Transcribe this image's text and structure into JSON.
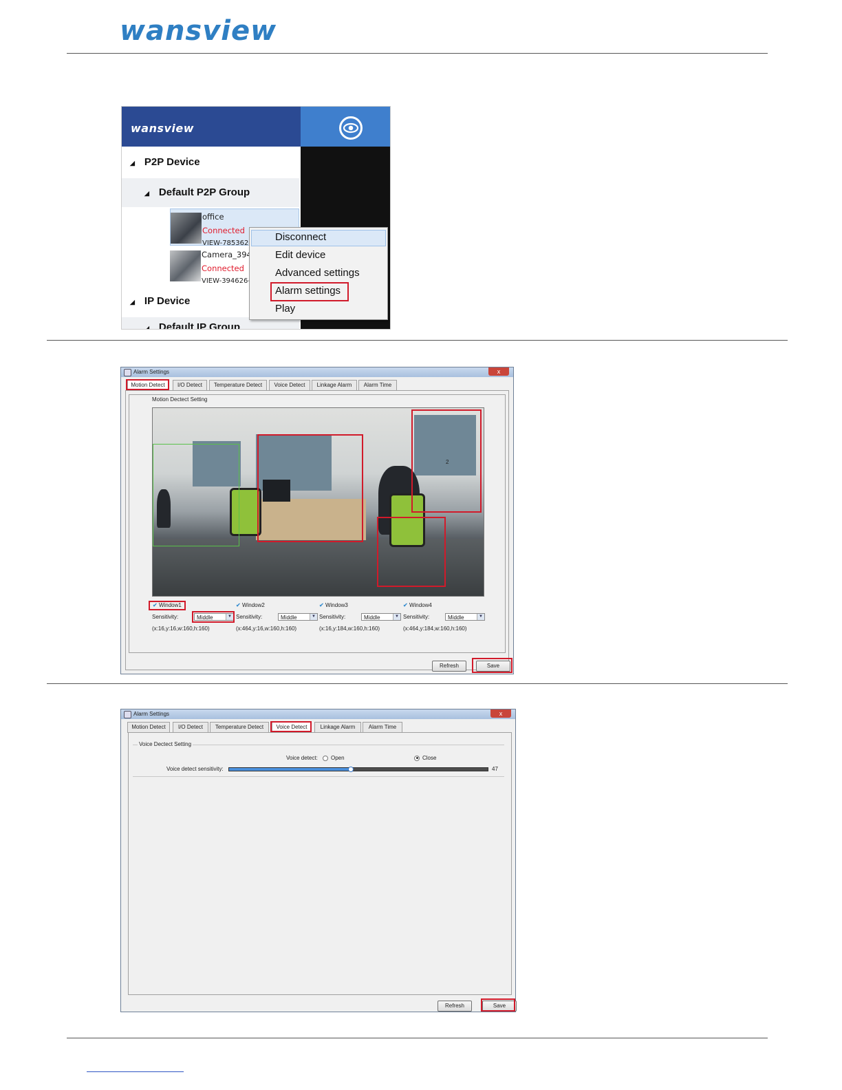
{
  "header": {
    "logo_text": "wansview"
  },
  "panel1": {
    "brand": "wansview",
    "tree": {
      "p2p_device": "P2P Device",
      "default_group": "Default P2P Group",
      "ip_device": "IP Device",
      "partial_next": "Default IP Group"
    },
    "devices": [
      {
        "name": "office",
        "status": "Connected",
        "id": "VIEW-785362-"
      },
      {
        "name": "Camera_394",
        "status": "Connected",
        "id": "VIEW-394626-"
      }
    ],
    "context_menu": [
      "Disconnect",
      "Edit device",
      "Advanced settings",
      "Alarm settings",
      "Play"
    ]
  },
  "dialog1": {
    "title": "Alarm Settings",
    "close": "x",
    "tabs": [
      "Motion Detect",
      "I/O Detect",
      "Temperature Detect",
      "Voice Detect",
      "Linkage Alarm",
      "Alarm Time"
    ],
    "section_title": "Motion Dectect Setting",
    "region_label": "2",
    "windows": [
      {
        "label": "Window1",
        "sensitivity_label": "Sensitivity:",
        "sensitivity": "Middle",
        "coords": "(x:16,y:16,w:160,h:160)"
      },
      {
        "label": "Window2",
        "sensitivity_label": "Sensitivity:",
        "sensitivity": "Middle",
        "coords": "(x:464,y:16,w:160,h:160)"
      },
      {
        "label": "Window3",
        "sensitivity_label": "Sensitivity:",
        "sensitivity": "Middle",
        "coords": "(x:16,y:184,w:160,h:160)"
      },
      {
        "label": "Window4",
        "sensitivity_label": "Sensitivity:",
        "sensitivity": "Middle",
        "coords": "(x:464,y:184,w:160,h:160)"
      }
    ],
    "refresh": "Refresh",
    "save": "Save"
  },
  "dialog2": {
    "title": "Alarm Settings",
    "close": "x",
    "tabs": [
      "Motion Detect",
      "I/O Detect",
      "Temperature Detect",
      "Voice Detect",
      "Linkage Alarm",
      "Alarm Time"
    ],
    "section_title": "Voice Dectect Setting",
    "voice_detect_label": "Voice detect:",
    "open_label": "Open",
    "close_label": "Close",
    "sensitivity_label": "Voice detect sensitivity:",
    "sensitivity_value": "47",
    "sensitivity_fraction": 0.47,
    "refresh": "Refresh",
    "save": "Save"
  },
  "colors": {
    "highlight_red": "#d11a2a",
    "brand_blue": "#2f7fc3",
    "topbar_blue": "#2b4a93"
  }
}
